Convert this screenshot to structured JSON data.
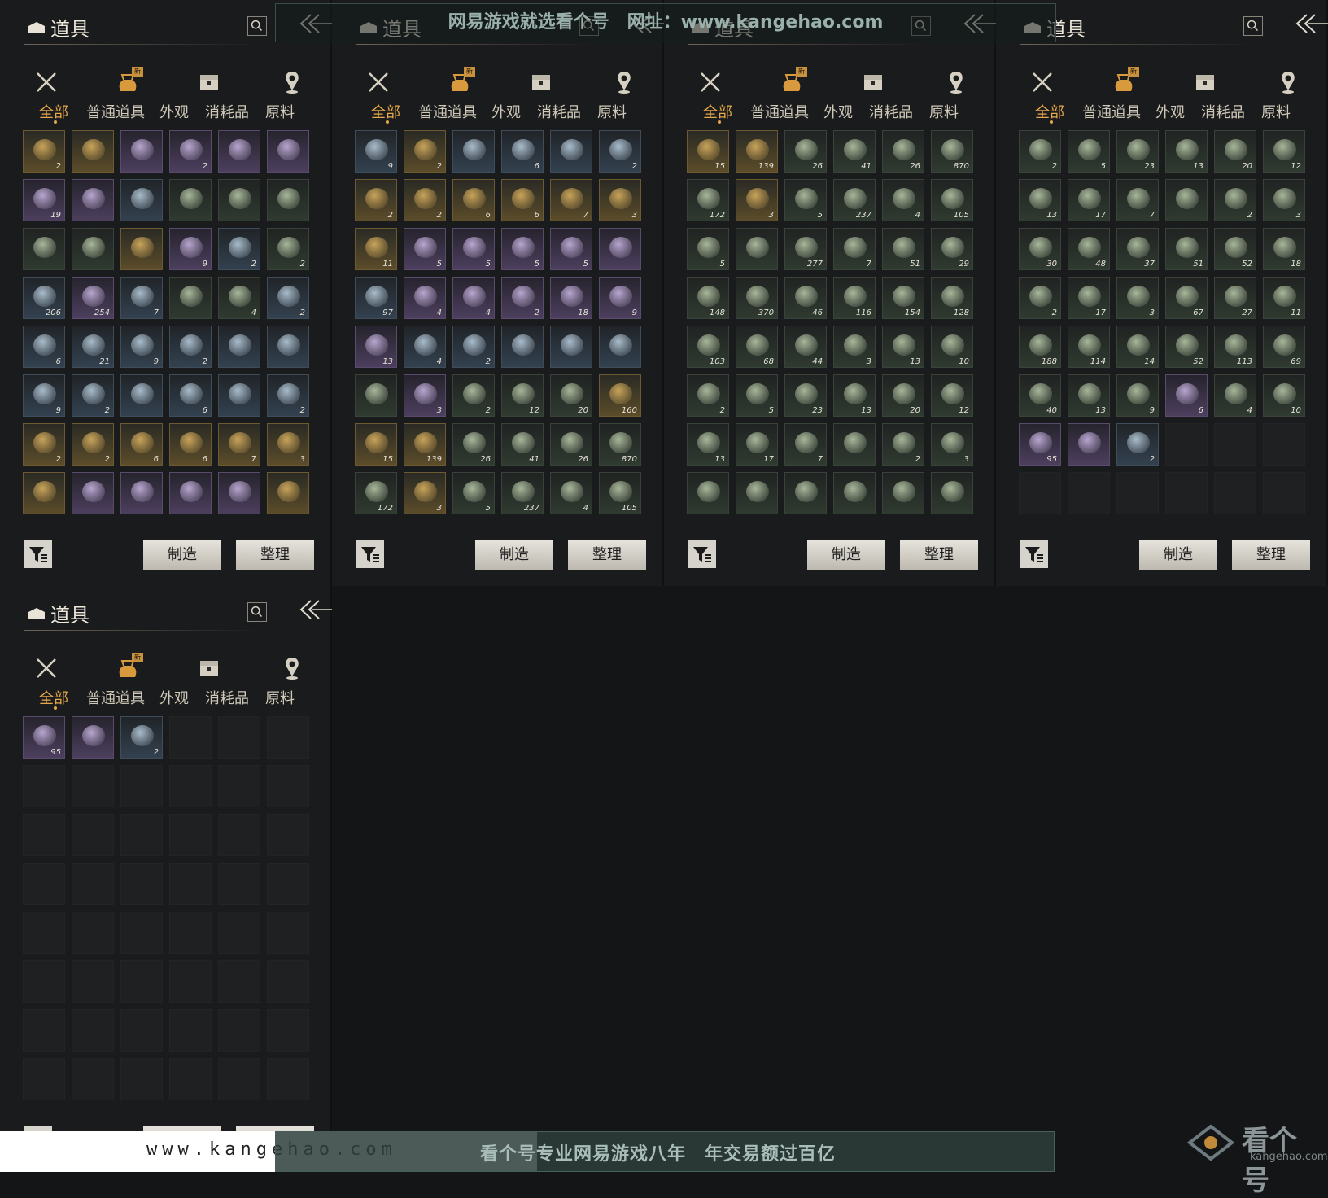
{
  "panel": {
    "title": "道具",
    "category_icons": [
      "weapon-icon",
      "item-bag-icon",
      "chest-icon",
      "location-pin-icon"
    ],
    "new_badge": "新",
    "tabs": [
      "全部",
      "普通道具",
      "外观",
      "消耗品",
      "原料"
    ],
    "active_tab": "全部",
    "craft_button": "制造",
    "sort_button": "整理"
  },
  "panels": [
    {
      "id": "p1",
      "slots": [
        {
          "t": "g",
          "c": "2"
        },
        {
          "t": "g",
          "c": ""
        },
        {
          "t": "p",
          "c": ""
        },
        {
          "t": "p",
          "c": "2"
        },
        {
          "t": "p",
          "c": ""
        },
        {
          "t": "p",
          "c": ""
        },
        {
          "t": "p",
          "c": "19"
        },
        {
          "t": "p",
          "c": ""
        },
        {
          "t": "b",
          "c": ""
        },
        {
          "t": "n",
          "c": ""
        },
        {
          "t": "n",
          "c": ""
        },
        {
          "t": "n",
          "c": ""
        },
        {
          "t": "n",
          "c": ""
        },
        {
          "t": "n",
          "c": ""
        },
        {
          "t": "g",
          "c": ""
        },
        {
          "t": "p",
          "c": "9"
        },
        {
          "t": "b",
          "c": "2"
        },
        {
          "t": "n",
          "c": "2"
        },
        {
          "t": "b",
          "c": "206"
        },
        {
          "t": "p",
          "c": "254"
        },
        {
          "t": "b",
          "c": "7"
        },
        {
          "t": "n",
          "c": ""
        },
        {
          "t": "n",
          "c": "4"
        },
        {
          "t": "b",
          "c": "2"
        },
        {
          "t": "b",
          "c": "6"
        },
        {
          "t": "b",
          "c": "21"
        },
        {
          "t": "b",
          "c": "9"
        },
        {
          "t": "b",
          "c": "2"
        },
        {
          "t": "b",
          "c": ""
        },
        {
          "t": "b",
          "c": ""
        },
        {
          "t": "b",
          "c": "9"
        },
        {
          "t": "b",
          "c": "2"
        },
        {
          "t": "b",
          "c": ""
        },
        {
          "t": "b",
          "c": "6"
        },
        {
          "t": "b",
          "c": ""
        },
        {
          "t": "b",
          "c": "2"
        },
        {
          "t": "g",
          "c": "2"
        },
        {
          "t": "g",
          "c": "2"
        },
        {
          "t": "g",
          "c": "6"
        },
        {
          "t": "g",
          "c": "6"
        },
        {
          "t": "g",
          "c": "7"
        },
        {
          "t": "g",
          "c": "3"
        },
        {
          "t": "g",
          "c": ""
        },
        {
          "t": "p",
          "c": ""
        },
        {
          "t": "p",
          "c": ""
        },
        {
          "t": "p",
          "c": ""
        },
        {
          "t": "p",
          "c": ""
        },
        {
          "t": "g",
          "c": ""
        }
      ]
    },
    {
      "id": "p2",
      "slots": [
        {
          "t": "b",
          "c": "9"
        },
        {
          "t": "g",
          "c": "2"
        },
        {
          "t": "b",
          "c": ""
        },
        {
          "t": "b",
          "c": "6"
        },
        {
          "t": "b",
          "c": ""
        },
        {
          "t": "b",
          "c": "2"
        },
        {
          "t": "g",
          "c": "2"
        },
        {
          "t": "g",
          "c": "2"
        },
        {
          "t": "g",
          "c": "6"
        },
        {
          "t": "g",
          "c": "6"
        },
        {
          "t": "g",
          "c": "7"
        },
        {
          "t": "g",
          "c": "3"
        },
        {
          "t": "g",
          "c": "11"
        },
        {
          "t": "p",
          "c": "5"
        },
        {
          "t": "p",
          "c": "5"
        },
        {
          "t": "p",
          "c": "5"
        },
        {
          "t": "p",
          "c": "5"
        },
        {
          "t": "p",
          "c": ""
        },
        {
          "t": "b",
          "c": "97"
        },
        {
          "t": "p",
          "c": "4"
        },
        {
          "t": "p",
          "c": "4"
        },
        {
          "t": "p",
          "c": "2"
        },
        {
          "t": "p",
          "c": "18"
        },
        {
          "t": "p",
          "c": "9"
        },
        {
          "t": "p",
          "c": "13"
        },
        {
          "t": "b",
          "c": "4"
        },
        {
          "t": "b",
          "c": "2"
        },
        {
          "t": "b",
          "c": ""
        },
        {
          "t": "b",
          "c": ""
        },
        {
          "t": "b",
          "c": ""
        },
        {
          "t": "n",
          "c": ""
        },
        {
          "t": "p",
          "c": "3"
        },
        {
          "t": "n",
          "c": "2"
        },
        {
          "t": "n",
          "c": "12"
        },
        {
          "t": "n",
          "c": "20"
        },
        {
          "t": "g",
          "c": "160"
        },
        {
          "t": "g",
          "c": "15"
        },
        {
          "t": "g",
          "c": "139"
        },
        {
          "t": "n",
          "c": "26"
        },
        {
          "t": "n",
          "c": "41"
        },
        {
          "t": "n",
          "c": "26"
        },
        {
          "t": "n",
          "c": "870"
        },
        {
          "t": "n",
          "c": "172"
        },
        {
          "t": "g",
          "c": "3"
        },
        {
          "t": "n",
          "c": "5"
        },
        {
          "t": "n",
          "c": "237"
        },
        {
          "t": "n",
          "c": "4"
        },
        {
          "t": "n",
          "c": "105"
        }
      ]
    },
    {
      "id": "p3",
      "slots": [
        {
          "t": "g",
          "c": "15"
        },
        {
          "t": "g",
          "c": "139"
        },
        {
          "t": "n",
          "c": "26"
        },
        {
          "t": "n",
          "c": "41"
        },
        {
          "t": "n",
          "c": "26"
        },
        {
          "t": "n",
          "c": "870"
        },
        {
          "t": "n",
          "c": "172"
        },
        {
          "t": "g",
          "c": "3"
        },
        {
          "t": "n",
          "c": "5"
        },
        {
          "t": "n",
          "c": "237"
        },
        {
          "t": "n",
          "c": "4"
        },
        {
          "t": "n",
          "c": "105"
        },
        {
          "t": "n",
          "c": "5"
        },
        {
          "t": "n",
          "c": ""
        },
        {
          "t": "n",
          "c": "277"
        },
        {
          "t": "n",
          "c": "7"
        },
        {
          "t": "n",
          "c": "51"
        },
        {
          "t": "n",
          "c": "29"
        },
        {
          "t": "n",
          "c": "148"
        },
        {
          "t": "n",
          "c": "370"
        },
        {
          "t": "n",
          "c": "46"
        },
        {
          "t": "n",
          "c": "116"
        },
        {
          "t": "n",
          "c": "154"
        },
        {
          "t": "n",
          "c": "128"
        },
        {
          "t": "n",
          "c": "103"
        },
        {
          "t": "n",
          "c": "68"
        },
        {
          "t": "n",
          "c": "44"
        },
        {
          "t": "n",
          "c": "3"
        },
        {
          "t": "n",
          "c": "13"
        },
        {
          "t": "n",
          "c": "10"
        },
        {
          "t": "n",
          "c": "2"
        },
        {
          "t": "n",
          "c": "5"
        },
        {
          "t": "n",
          "c": "23"
        },
        {
          "t": "n",
          "c": "13"
        },
        {
          "t": "n",
          "c": "20"
        },
        {
          "t": "n",
          "c": "12"
        },
        {
          "t": "n",
          "c": "13"
        },
        {
          "t": "n",
          "c": "17"
        },
        {
          "t": "n",
          "c": "7"
        },
        {
          "t": "n",
          "c": ""
        },
        {
          "t": "n",
          "c": "2"
        },
        {
          "t": "n",
          "c": "3"
        },
        {
          "t": "n",
          "c": ""
        },
        {
          "t": "n",
          "c": ""
        },
        {
          "t": "n",
          "c": ""
        },
        {
          "t": "n",
          "c": ""
        },
        {
          "t": "n",
          "c": ""
        },
        {
          "t": "n",
          "c": ""
        }
      ]
    },
    {
      "id": "p4",
      "slots": [
        {
          "t": "n",
          "c": "2"
        },
        {
          "t": "n",
          "c": "5"
        },
        {
          "t": "n",
          "c": "23"
        },
        {
          "t": "n",
          "c": "13"
        },
        {
          "t": "n",
          "c": "20"
        },
        {
          "t": "n",
          "c": "12"
        },
        {
          "t": "n",
          "c": "13"
        },
        {
          "t": "n",
          "c": "17"
        },
        {
          "t": "n",
          "c": "7"
        },
        {
          "t": "n",
          "c": ""
        },
        {
          "t": "n",
          "c": "2"
        },
        {
          "t": "n",
          "c": "3"
        },
        {
          "t": "n",
          "c": "30"
        },
        {
          "t": "n",
          "c": "48"
        },
        {
          "t": "n",
          "c": "37"
        },
        {
          "t": "n",
          "c": "51"
        },
        {
          "t": "n",
          "c": "52"
        },
        {
          "t": "n",
          "c": "18"
        },
        {
          "t": "n",
          "c": "2"
        },
        {
          "t": "n",
          "c": "17"
        },
        {
          "t": "n",
          "c": "3"
        },
        {
          "t": "n",
          "c": "67"
        },
        {
          "t": "n",
          "c": "27"
        },
        {
          "t": "n",
          "c": "11"
        },
        {
          "t": "n",
          "c": "188"
        },
        {
          "t": "n",
          "c": "114"
        },
        {
          "t": "n",
          "c": "14"
        },
        {
          "t": "n",
          "c": "52"
        },
        {
          "t": "n",
          "c": "113"
        },
        {
          "t": "n",
          "c": "69"
        },
        {
          "t": "n",
          "c": "40"
        },
        {
          "t": "n",
          "c": "13"
        },
        {
          "t": "n",
          "c": "9"
        },
        {
          "t": "p",
          "c": "6"
        },
        {
          "t": "n",
          "c": "4"
        },
        {
          "t": "n",
          "c": "10"
        },
        {
          "t": "p",
          "c": "95"
        },
        {
          "t": "p",
          "c": ""
        },
        {
          "t": "b",
          "c": "2"
        },
        {
          "t": "e",
          "c": ""
        },
        {
          "t": "e",
          "c": ""
        },
        {
          "t": "e",
          "c": ""
        },
        {
          "t": "e",
          "c": ""
        },
        {
          "t": "e",
          "c": ""
        },
        {
          "t": "e",
          "c": ""
        },
        {
          "t": "e",
          "c": ""
        },
        {
          "t": "e",
          "c": ""
        },
        {
          "t": "e",
          "c": ""
        }
      ]
    },
    {
      "id": "p5",
      "slots": [
        {
          "t": "p",
          "c": "95"
        },
        {
          "t": "p",
          "c": ""
        },
        {
          "t": "b",
          "c": "2"
        },
        {
          "t": "e",
          "c": ""
        },
        {
          "t": "e",
          "c": ""
        },
        {
          "t": "e",
          "c": ""
        },
        {
          "t": "e",
          "c": ""
        },
        {
          "t": "e",
          "c": ""
        },
        {
          "t": "e",
          "c": ""
        },
        {
          "t": "e",
          "c": ""
        },
        {
          "t": "e",
          "c": ""
        },
        {
          "t": "e",
          "c": ""
        },
        {
          "t": "e",
          "c": ""
        },
        {
          "t": "e",
          "c": ""
        },
        {
          "t": "e",
          "c": ""
        },
        {
          "t": "e",
          "c": ""
        },
        {
          "t": "e",
          "c": ""
        },
        {
          "t": "e",
          "c": ""
        },
        {
          "t": "e",
          "c": ""
        },
        {
          "t": "e",
          "c": ""
        },
        {
          "t": "e",
          "c": ""
        },
        {
          "t": "e",
          "c": ""
        },
        {
          "t": "e",
          "c": ""
        },
        {
          "t": "e",
          "c": ""
        },
        {
          "t": "e",
          "c": ""
        },
        {
          "t": "e",
          "c": ""
        },
        {
          "t": "e",
          "c": ""
        },
        {
          "t": "e",
          "c": ""
        },
        {
          "t": "e",
          "c": ""
        },
        {
          "t": "e",
          "c": ""
        },
        {
          "t": "e",
          "c": ""
        },
        {
          "t": "e",
          "c": ""
        },
        {
          "t": "e",
          "c": ""
        },
        {
          "t": "e",
          "c": ""
        },
        {
          "t": "e",
          "c": ""
        },
        {
          "t": "e",
          "c": ""
        },
        {
          "t": "e",
          "c": ""
        },
        {
          "t": "e",
          "c": ""
        },
        {
          "t": "e",
          "c": ""
        },
        {
          "t": "e",
          "c": ""
        },
        {
          "t": "e",
          "c": ""
        },
        {
          "t": "e",
          "c": ""
        },
        {
          "t": "e",
          "c": ""
        },
        {
          "t": "e",
          "c": ""
        },
        {
          "t": "e",
          "c": ""
        },
        {
          "t": "e",
          "c": ""
        },
        {
          "t": "e",
          "c": ""
        },
        {
          "t": "e",
          "c": ""
        }
      ]
    }
  ],
  "watermark": {
    "top": "网易游戏就选看个号　网址：www.kangehao.com",
    "footer_site": "www.kangehao.com",
    "footer_slogan": "看个号专业网易游戏八年　年交易额过百亿",
    "logo_text": "看个号",
    "logo_sub": "kangehao.com"
  },
  "colors": {
    "accent": "#e6a84b",
    "gold_slot": "#5b4c2a",
    "purple_slot": "#4c3f5e",
    "blue_slot": "#33414f",
    "green_slot": "#2f3a30"
  }
}
